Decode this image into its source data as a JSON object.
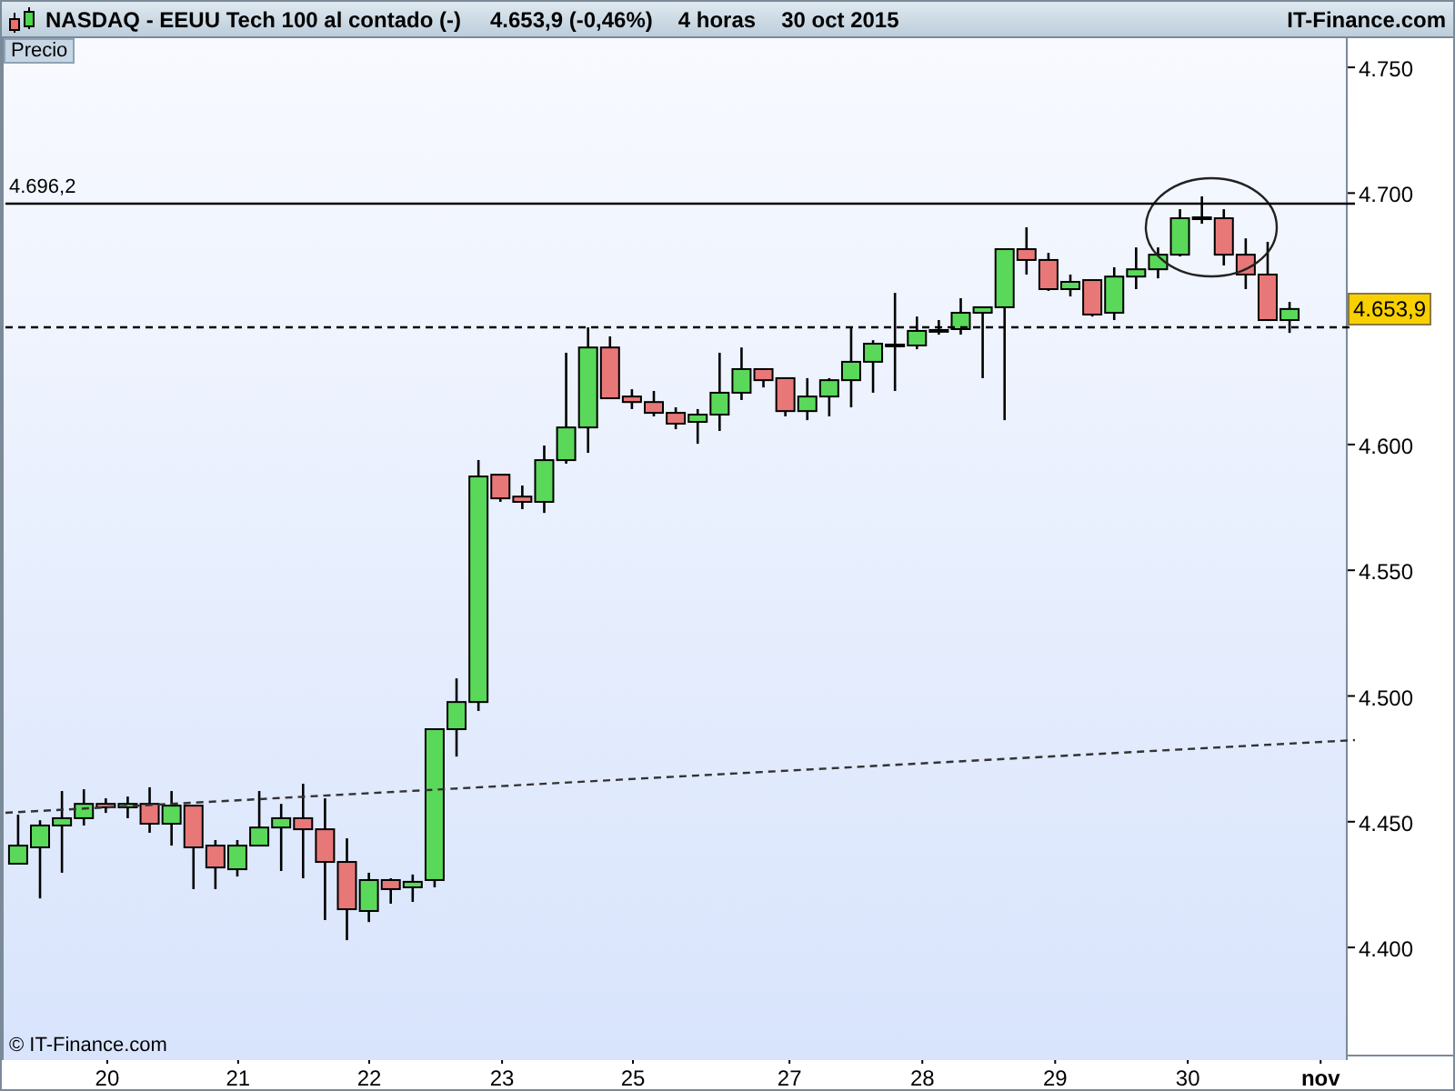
{
  "header": {
    "instrument": "NASDAQ - EEUU Tech 100 al contado (-)",
    "quote": "4.653,9 (-0,46%)",
    "interval": "4 horas",
    "date": "30 oct 2015",
    "brand": "IT-Finance.com"
  },
  "copyright": "© IT-Finance.com",
  "price_tag": "4.653,9",
  "chart_data": {
    "type": "candlestick",
    "ylabel": "Precio",
    "categories": [
      null,
      null,
      null,
      null,
      null,
      null,
      null,
      null,
      null,
      null,
      null,
      null,
      null,
      null,
      null,
      null,
      null,
      null,
      null,
      null,
      null,
      null,
      null,
      null,
      null,
      null,
      null,
      null,
      null,
      null,
      null,
      null,
      null,
      null,
      null,
      null,
      null,
      null,
      null,
      null,
      null,
      null,
      null,
      null,
      null,
      null,
      null,
      null,
      null,
      null,
      null,
      null,
      null,
      null,
      null,
      null,
      null,
      null,
      null
    ],
    "ohlc": [
      [
        4433.3,
        4452.8,
        4433.3,
        4440.5
      ],
      [
        4439.8,
        4450.6,
        4419.5,
        4448.5
      ],
      [
        4448.5,
        4462.2,
        4429.7,
        4451.4
      ],
      [
        4451.4,
        4462.9,
        4448.5,
        4457.1
      ],
      [
        4457.1,
        4459.3,
        4453.5,
        4455.7
      ],
      [
        4455.7,
        4460.0,
        4451.4,
        4457.1
      ],
      [
        4457.1,
        4463.7,
        4445.6,
        4449.2
      ],
      [
        4449.2,
        4462.2,
        4440.5,
        4456.4
      ],
      [
        4456.4,
        4456.4,
        4423.2,
        4439.8
      ],
      [
        4440.5,
        4442.7,
        4423.2,
        4431.8
      ],
      [
        4431.1,
        4442.7,
        4428.2,
        4440.5
      ],
      [
        4440.5,
        4462.2,
        4440.5,
        4447.7
      ],
      [
        4447.7,
        4457.1,
        4430.4,
        4451.4
      ],
      [
        4451.4,
        4465.1,
        4427.5,
        4447.0
      ],
      [
        4447.0,
        4459.3,
        4410.9,
        4434.0
      ],
      [
        4434.0,
        4443.4,
        4402.9,
        4415.2
      ],
      [
        4414.5,
        4429.7,
        4410.1,
        4426.8
      ],
      [
        4426.8,
        4427.5,
        4417.4,
        4423.2
      ],
      [
        4423.9,
        4429.0,
        4418.1,
        4426.1
      ],
      [
        4426.8,
        4486.8,
        4423.9,
        4486.8
      ],
      [
        4486.8,
        4507.0,
        4475.9,
        4497.6
      ],
      [
        4497.6,
        4593.8,
        4494.0,
        4587.3
      ],
      [
        4588.0,
        4588.0,
        4577.2,
        4578.6
      ],
      [
        4579.3,
        4583.7,
        4574.3,
        4577.2
      ],
      [
        4577.2,
        4599.6,
        4572.8,
        4593.8
      ],
      [
        4593.8,
        4636.5,
        4592.4,
        4606.8
      ],
      [
        4606.8,
        4646.6,
        4596.7,
        4638.6
      ],
      [
        4638.6,
        4643.0,
        4618.4,
        4618.4
      ],
      [
        4619.1,
        4622.0,
        4614.1,
        4616.9
      ],
      [
        4616.9,
        4621.3,
        4611.2,
        4612.6
      ],
      [
        4612.6,
        4614.8,
        4606.1,
        4608.3
      ],
      [
        4609.0,
        4614.1,
        4600.3,
        4611.9
      ],
      [
        4611.9,
        4636.5,
        4605.4,
        4620.6
      ],
      [
        4620.6,
        4638.6,
        4617.7,
        4630.0
      ],
      [
        4630.0,
        4630.0,
        4622.7,
        4625.6
      ],
      [
        4626.4,
        4626.4,
        4611.2,
        4613.3
      ],
      [
        4613.3,
        4626.4,
        4609.7,
        4619.1
      ],
      [
        4619.1,
        4626.4,
        4611.2,
        4625.6
      ],
      [
        4625.6,
        4646.6,
        4614.8,
        4632.9
      ],
      [
        4632.9,
        4641.5,
        4620.6,
        4640.1
      ],
      [
        4639.4,
        4660.3,
        4621.3,
        4639.4
      ],
      [
        4639.4,
        4650.9,
        4637.9,
        4645.2
      ],
      [
        4645.2,
        4649.5,
        4643.7,
        4645.2
      ],
      [
        4645.9,
        4658.2,
        4643.7,
        4652.4
      ],
      [
        4652.4,
        4654.6,
        4626.4,
        4654.6
      ],
      [
        4654.6,
        4677.7,
        4609.7,
        4677.7
      ],
      [
        4677.7,
        4686.4,
        4667.6,
        4673.4
      ],
      [
        4673.4,
        4676.2,
        4661.1,
        4661.8
      ],
      [
        4661.8,
        4667.6,
        4658.9,
        4664.7
      ],
      [
        4665.4,
        4665.4,
        4650.9,
        4651.7
      ],
      [
        4652.4,
        4670.5,
        4649.5,
        4666.8
      ],
      [
        4666.8,
        4678.4,
        4661.8,
        4669.7
      ],
      [
        4669.7,
        4678.4,
        4666.1,
        4675.5
      ],
      [
        4675.5,
        4693.6,
        4674.8,
        4690.0
      ],
      [
        4690.0,
        4698.7,
        4687.8,
        4690.0
      ],
      [
        4690.0,
        4693.6,
        4671.2,
        4675.5
      ],
      [
        4675.5,
        4682.0,
        4661.8,
        4667.6
      ],
      [
        4667.6,
        4680.6,
        4649.5,
        4649.5
      ],
      [
        4649.5,
        4656.7,
        4644.4,
        4653.9
      ]
    ],
    "yticks": [
      {
        "value": 4400,
        "label": "4.400"
      },
      {
        "value": 4450,
        "label": "4.450"
      },
      {
        "value": 4500,
        "label": "4.500"
      },
      {
        "value": 4550,
        "label": "4.550"
      },
      {
        "value": 4600,
        "label": "4.600"
      },
      {
        "value": 4700,
        "label": "4.700"
      },
      {
        "value": 4750,
        "label": "4.750"
      }
    ],
    "ylim": [
      4355.2,
      4761.6
    ]
  },
  "resistance_label": "4.696,2",
  "date_axis": [
    {
      "label": "20",
      "kind": "day"
    },
    {
      "label": "21",
      "kind": "day"
    },
    {
      "label": "22",
      "kind": "day"
    },
    {
      "label": "23",
      "kind": "day"
    },
    {
      "label": "25",
      "kind": "day"
    },
    {
      "label": "27",
      "kind": "day"
    },
    {
      "label": "28",
      "kind": "day"
    },
    {
      "label": "29",
      "kind": "day"
    },
    {
      "label": "30",
      "kind": "day"
    },
    {
      "label": "nov",
      "kind": "month"
    }
  ]
}
